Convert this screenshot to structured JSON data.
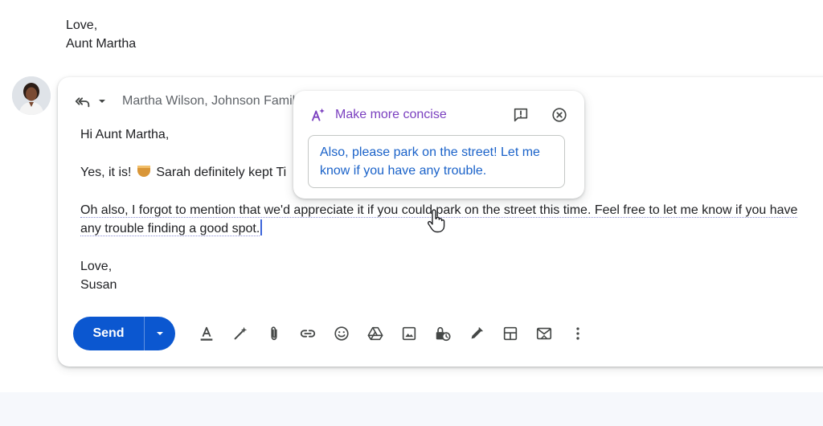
{
  "previous_message": {
    "closing": "Love,",
    "name": "Aunt Martha"
  },
  "compose": {
    "recipients": "Martha Wilson, Johnson Family",
    "body": {
      "greeting": "Hi Aunt Martha,",
      "line1_start": "Yes, it is!",
      "line1_rest": "Sarah definitely kept Ti",
      "line2": "Oh also, I forgot to mention that we'd appreciate it if you could park on the street this time. Feel free to let me know if you have any trouble finding a good spot.",
      "closing": "Love,",
      "signature": "Susan"
    },
    "send_label": "Send"
  },
  "ai_popup": {
    "title": "Make more concise",
    "suggestion": "Also, please park on the street! Let me know if you have any trouble."
  },
  "toolbar_icons": [
    "formatting-options-icon",
    "help-me-write-icon",
    "attach-file-icon",
    "insert-link-icon",
    "insert-emoji-icon",
    "google-drive-icon",
    "insert-photo-icon",
    "confidential-mode-icon",
    "insert-signature-icon",
    "layouts-icon",
    "switch-to-email-icon",
    "more-options-icon"
  ],
  "colors": {
    "send_button": "#0b57d0",
    "ai_accent": "#7a3fbf",
    "suggestion_text": "#1a62c9"
  }
}
